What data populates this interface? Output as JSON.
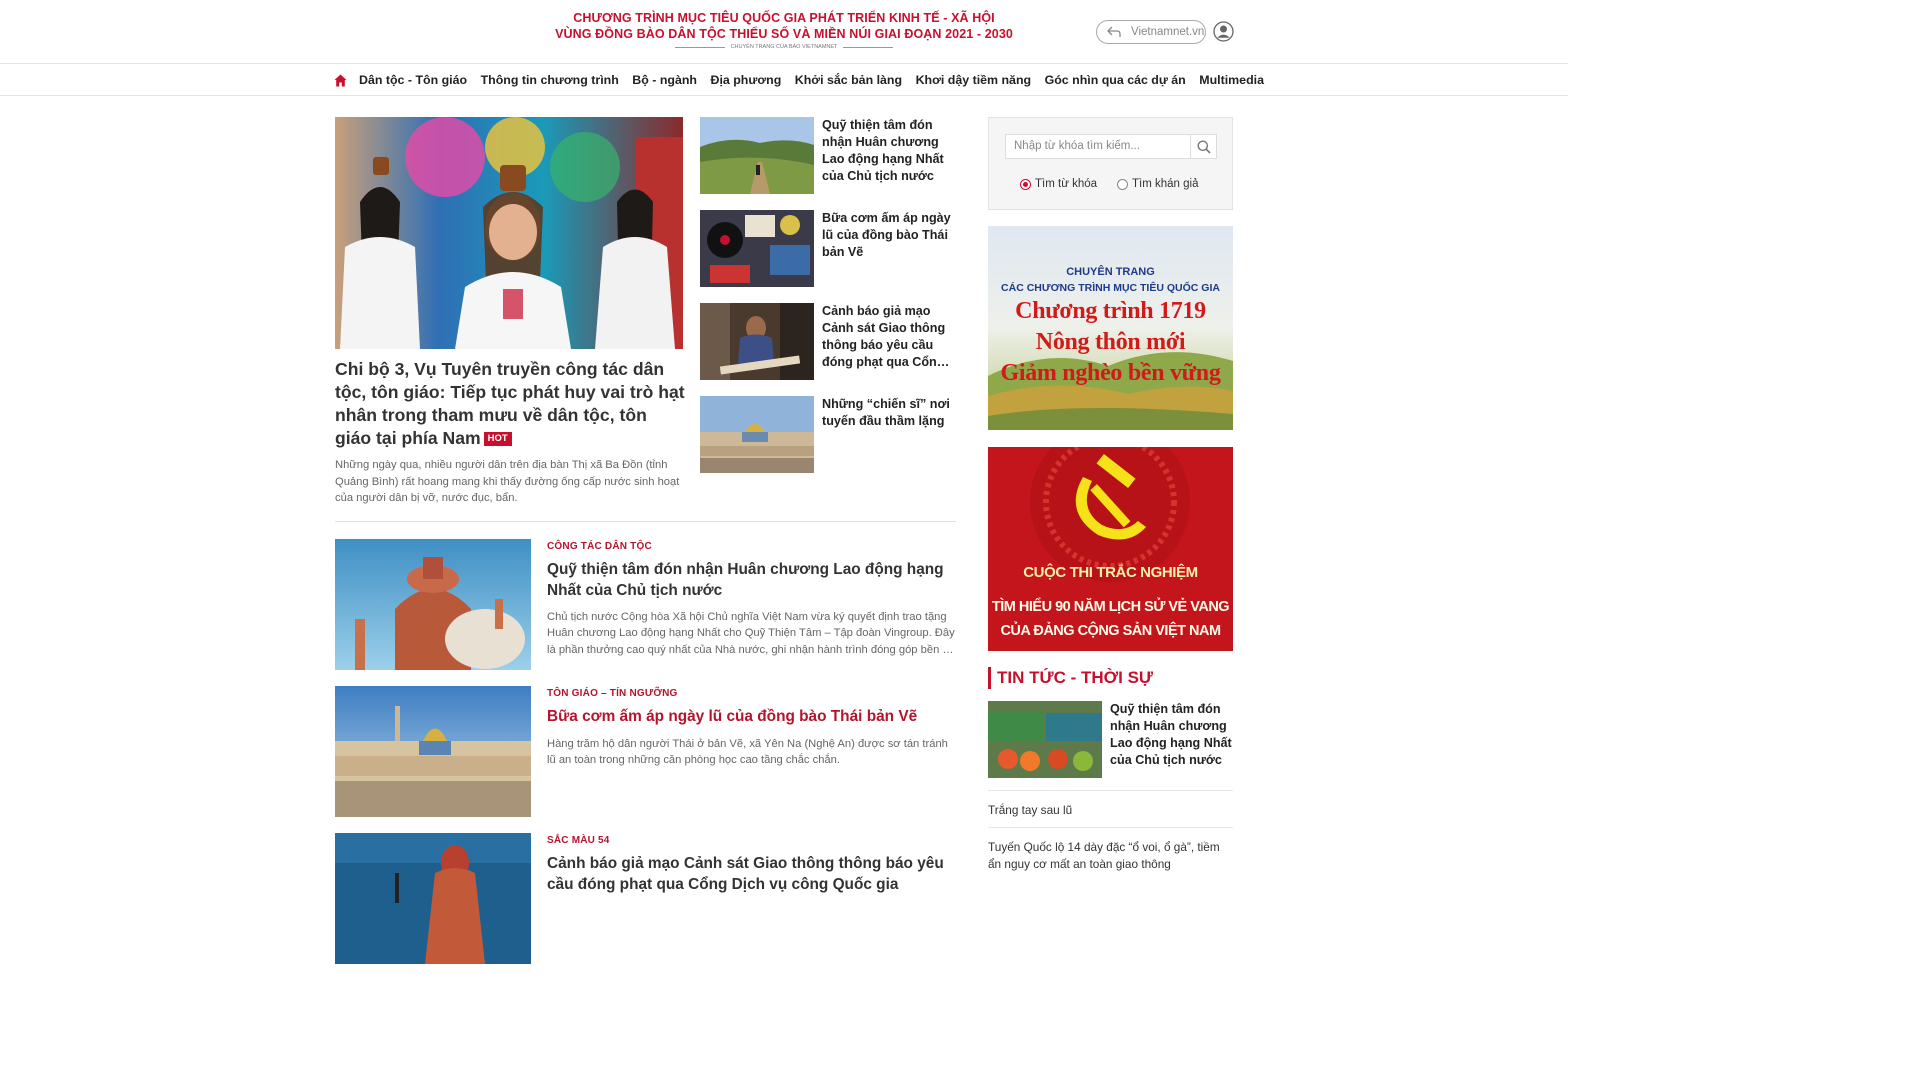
{
  "header": {
    "title_line1": "CHƯƠNG TRÌNH MỤC TIÊU QUỐC GIA PHÁT TRIỂN KINH TẾ - XÃ HỘI",
    "title_line2": "VÙNG ĐỒNG BÀO DÂN TỘC THIỂU SỐ VÀ MIỀN NÚI GIAI ĐOẠN 2021 - 2030",
    "subtitle": "CHUYÊN TRANG CỦA BÁO VIETNAMNET",
    "vnn_button": "Vietnamnet.vn",
    "colors": {
      "brand_red": "#c8102e"
    }
  },
  "nav": {
    "items": [
      {
        "label": "Dân tộc - Tôn giáo"
      },
      {
        "label": "Thông tin chương trình"
      },
      {
        "label": "Bộ - ngành"
      },
      {
        "label": "Địa phương"
      },
      {
        "label": "Khởi sắc bản làng"
      },
      {
        "label": "Khơi dậy tiềm năng"
      },
      {
        "label": "Góc nhìn qua các dự án"
      },
      {
        "label": "Multimedia"
      }
    ]
  },
  "featured": {
    "title": "Chi bộ 3, Vụ Tuyên truyền công tác dân tộc, tôn giáo: Tiếp tục phát huy vai trò hạt nhân trong tham mưu về dân tộc, tôn giáo tại phía Nam",
    "badge": "HOT",
    "sapo": "Những ngày qua, nhiều người dân trên địa bàn Thị xã Ba Đồn (tỉnh Quảng Bình) rất hoang mang khi thấy đường ống cấp nước sinh hoạt của người dân bị vỡ, nước đục, bẩn."
  },
  "side_list": [
    {
      "title": "Quỹ thiện tâm đón nhận Huân chương Lao động hạng Nhất của Chủ tịch nước"
    },
    {
      "title": "Bữa cơm ấm áp ngày lũ của đồng bào Thái bản Vẽ"
    },
    {
      "title": "Cảnh báo giả mạo Cảnh sát Giao thông thông báo yêu cầu đóng phạt qua Cổng Dịch vụ công Quốc gia"
    },
    {
      "title": "Những “chiến sĩ” nơi tuyến đầu thầm lặng"
    }
  ],
  "news_list": [
    {
      "category": "CÔNG TÁC DÂN TỘC",
      "title": "Quỹ thiện tâm đón nhận Huân chương Lao động hạng Nhất của Chủ tịch nước",
      "sapo": "Chủ tịch nước Cộng hòa Xã hội Chủ nghĩa Việt Nam vừa ký quyết định trao tặng Huân chương Lao động hạng Nhất cho Quỹ Thiện Tâm – Tập đoàn Vingroup. Đây là phần thưởng cao quý nhất của Nhà nước, ghi nhận hành trình đóng góp bền bỉ của Quỹ."
    },
    {
      "category": "TÔN GIÁO – TÍN NGƯỠNG",
      "title": "Bữa cơm ấm áp ngày lũ của đồng bào Thái bản Vẽ",
      "sapo": "Hàng trăm hộ dân người Thái ở bản Vẽ, xã Yên Na (Nghệ An) được sơ tán tránh lũ an toàn trong những căn phòng học cao tầng chắc chắn."
    },
    {
      "category": "SẮC MÀU 54",
      "title": "Cảnh báo giả mạo Cảnh sát Giao thông thông báo yêu cầu đóng phạt qua Cổng Dịch vụ công Quốc gia",
      "sapo": ""
    }
  ],
  "search": {
    "placeholder": "Nhập từ khóa tìm kiếm...",
    "option_keyword": "Tìm từ khóa",
    "option_audience": "Tìm khán giả"
  },
  "banner1": {
    "line1": "CHUYÊN TRANG",
    "line2": "CÁC CHƯƠNG TRÌNH MỤC TIÊU QUỐC GIA",
    "line3": "Chương trình 1719",
    "line4": "Nông thôn mới",
    "line5": "Giảm nghèo bền vững"
  },
  "banner2": {
    "line1": "CUỘC THI TRẮC NGHIỆM",
    "line2": "TÌM HIỂU 90 NĂM LỊCH SỬ VẺ VANG",
    "line3": "CỦA ĐẢNG CỘNG SẢN VIỆT NAM"
  },
  "right_news": {
    "heading": "TIN TỨC - THỜI SỰ",
    "top_item": {
      "title": "Quỹ thiện tâm đón nhận Huân chương Lao động hạng Nhất của Chủ tịch nước"
    },
    "links": [
      {
        "title": "Trắng tay sau lũ"
      },
      {
        "title": "Tuyến Quốc lộ 14 dày đặc “ổ voi, ổ gà”, tiềm ẩn nguy cơ mất an toàn giao thông"
      }
    ]
  }
}
